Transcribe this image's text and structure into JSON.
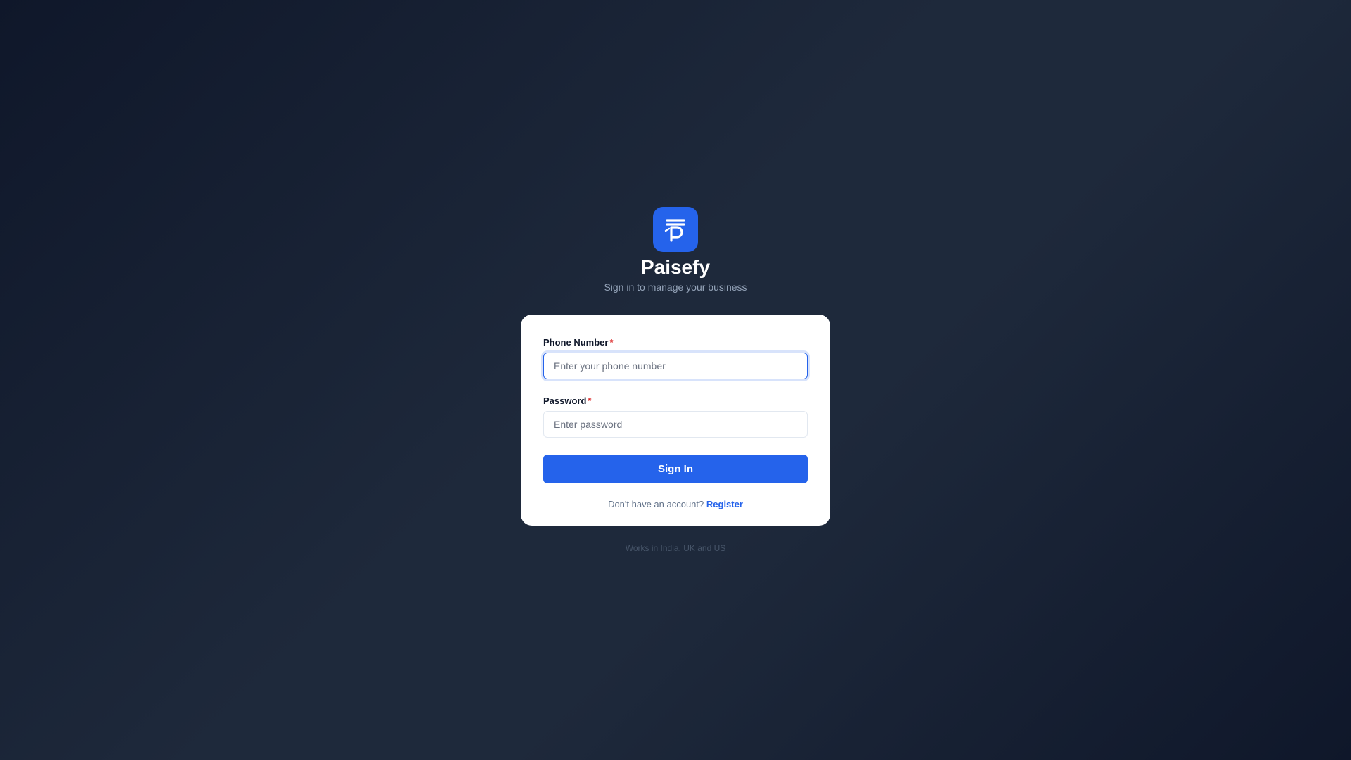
{
  "brand": {
    "logo_icon": "rupee-p-icon",
    "title": "Paisefy",
    "subtitle": "Sign in to manage your business"
  },
  "form": {
    "phone": {
      "label": "Phone Number",
      "required_mark": "*",
      "placeholder": "Enter your phone number",
      "value": ""
    },
    "password": {
      "label": "Password",
      "required_mark": "*",
      "placeholder": "Enter password",
      "value": ""
    },
    "submit_label": "Sign In",
    "register_prompt": "Don't have an account?",
    "register_link": "Register"
  },
  "footer": {
    "region_note": "Works in India, UK and US"
  },
  "colors": {
    "accent": "#2563eb",
    "background": "#0f172a",
    "required": "#dc2626"
  }
}
